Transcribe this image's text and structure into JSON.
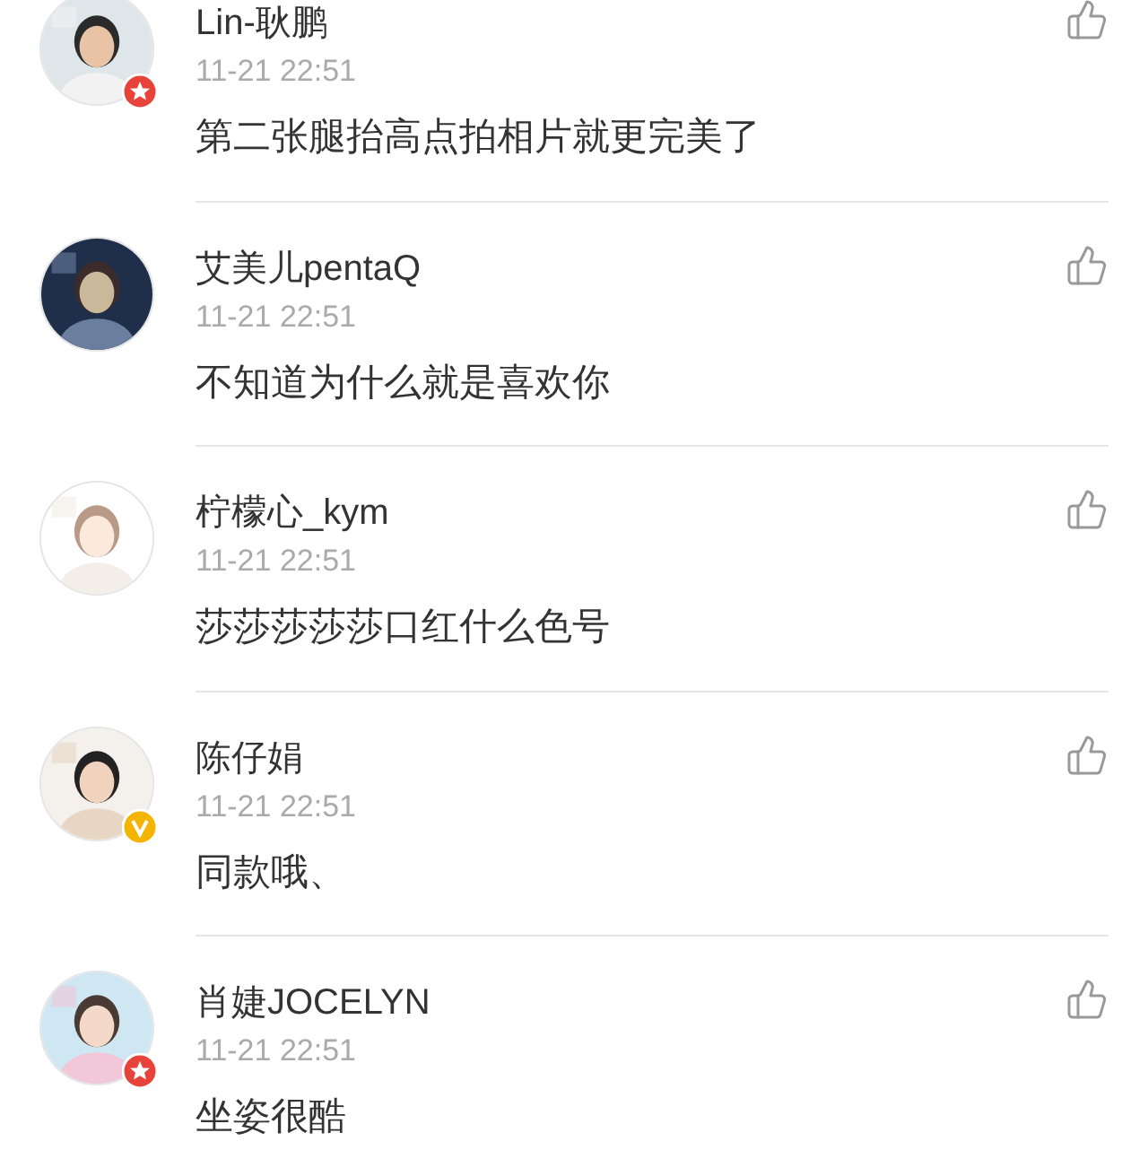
{
  "comments": [
    {
      "name": "Lin-耿鹏",
      "time": "11-21 22:51",
      "text": "第二张腿抬高点拍相片就更完美了",
      "kind": "member"
    },
    {
      "name": "艾美儿pentaQ",
      "time": "11-21 22:51",
      "text": "不知道为什么就是喜欢你",
      "kind": "plain"
    },
    {
      "name": "柠檬心_kym",
      "time": "11-21 22:51",
      "text": "莎莎莎莎莎口红什么色号",
      "kind": "plain"
    },
    {
      "name": "陈仔娟",
      "time": "11-21 22:51",
      "text": "同款哦、",
      "kind": "verified"
    },
    {
      "name": "肖婕JOCELYN",
      "time": "11-21 22:51",
      "text": "坐姿很酷",
      "kind": "member"
    }
  ]
}
